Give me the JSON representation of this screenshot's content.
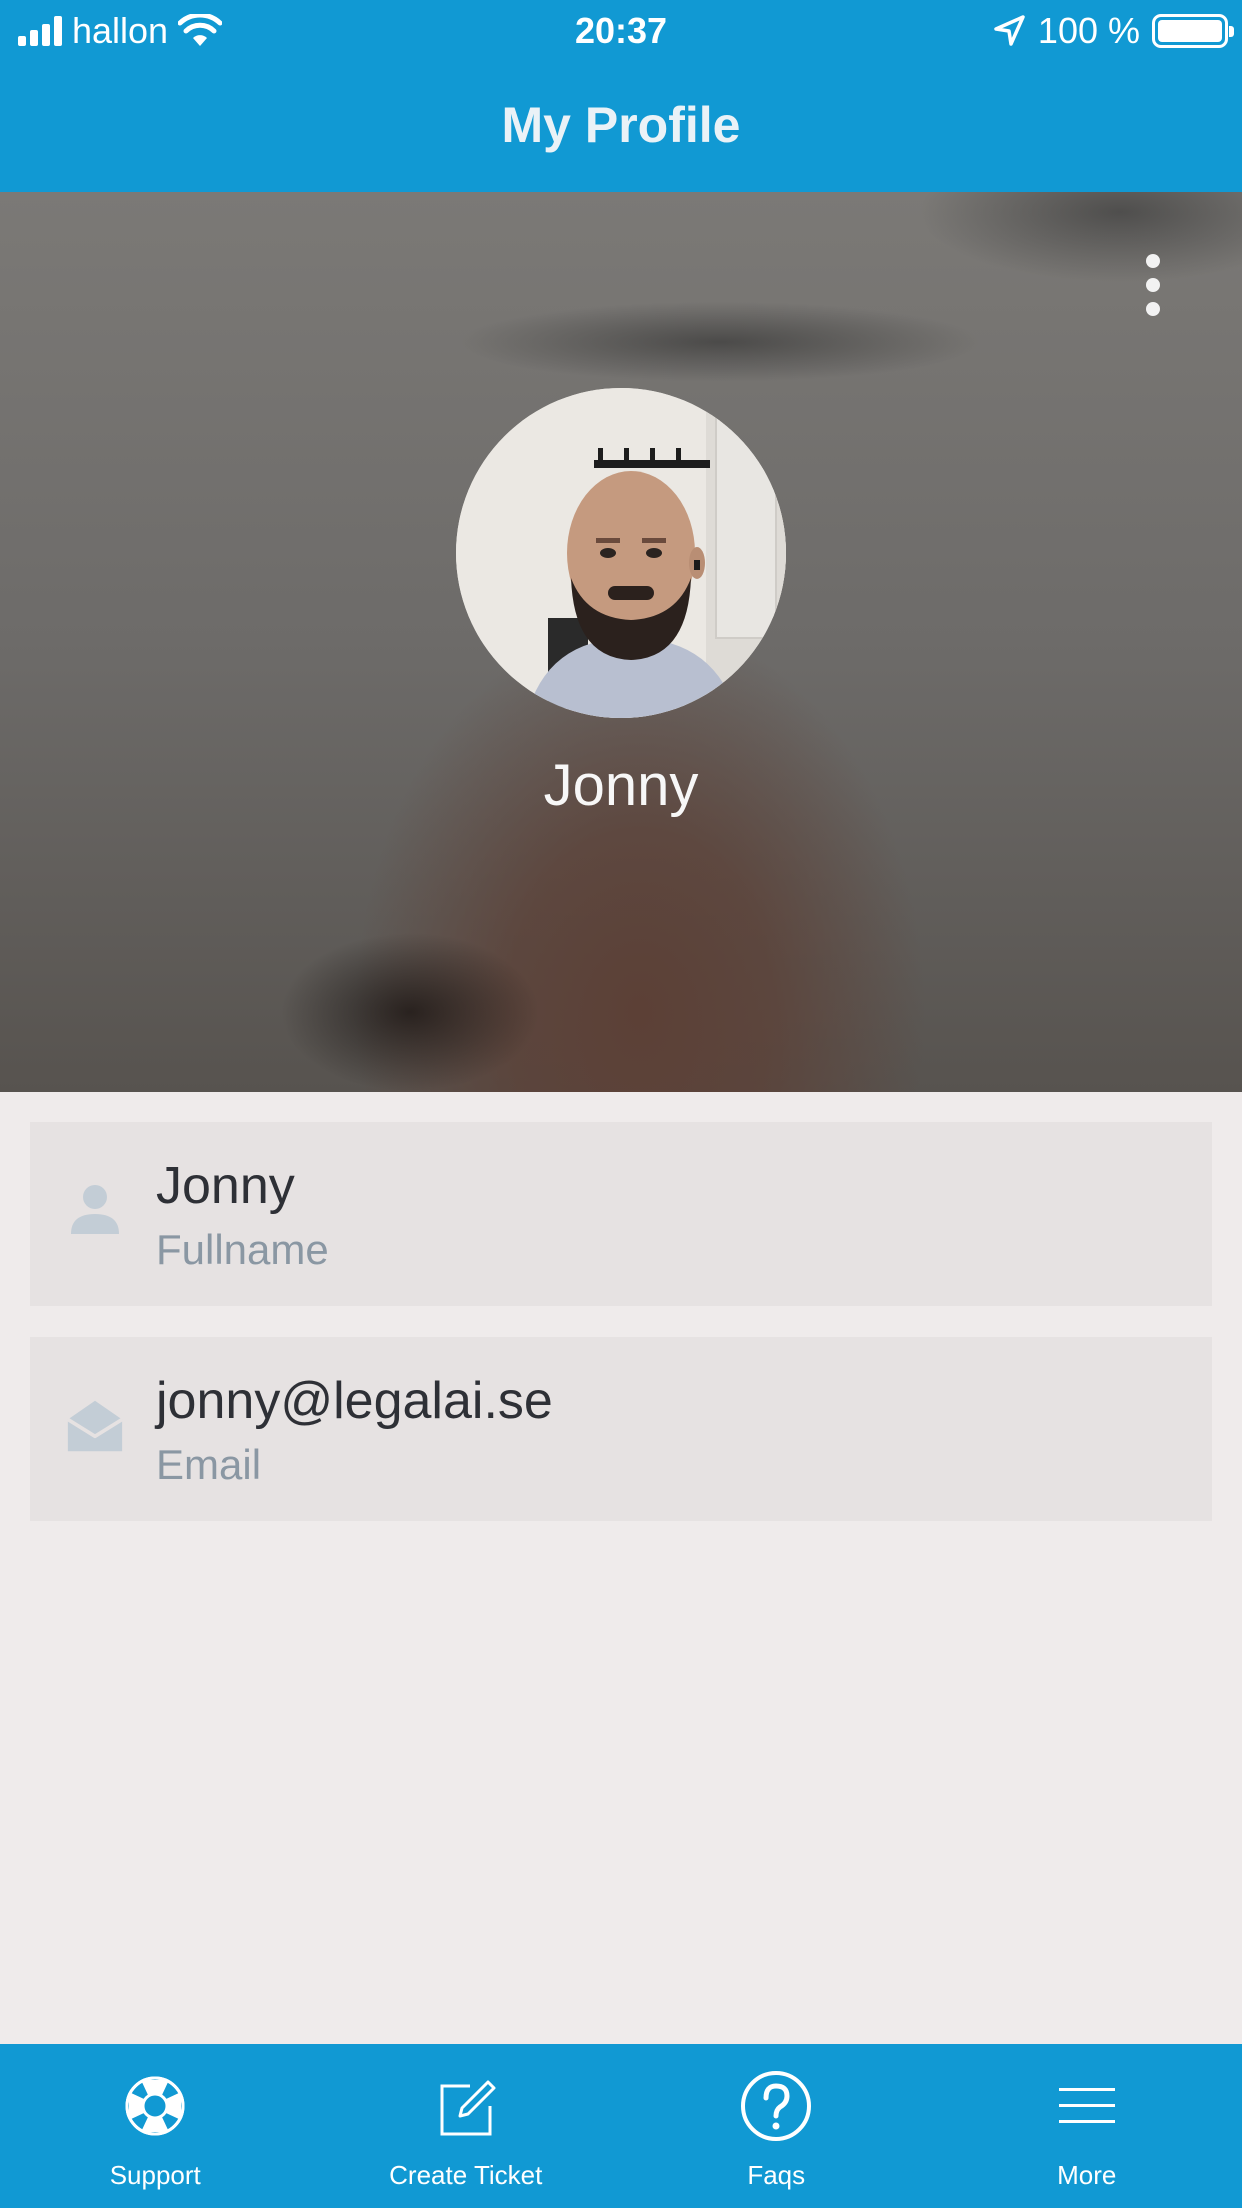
{
  "status_bar": {
    "carrier": "hallon",
    "time": "20:37",
    "battery": "100 %"
  },
  "header": {
    "title": "My Profile"
  },
  "profile": {
    "display_name": "Jonny"
  },
  "fields": [
    {
      "value": "Jonny",
      "label": "Fullname",
      "icon": "person-icon"
    },
    {
      "value": "jonny@legalai.se",
      "label": "Email",
      "icon": "envelope-open-icon"
    }
  ],
  "tabs": [
    {
      "label": "Support",
      "icon": "lifebuoy-icon"
    },
    {
      "label": "Create Ticket",
      "icon": "edit-icon"
    },
    {
      "label": "Faqs",
      "icon": "question-circle-icon"
    },
    {
      "label": "More",
      "icon": "menu-icon"
    }
  ],
  "colors": {
    "accent": "#1199d3",
    "background": "#efebeb",
    "card": "#e6e2e2",
    "label": "#8a97a3"
  }
}
